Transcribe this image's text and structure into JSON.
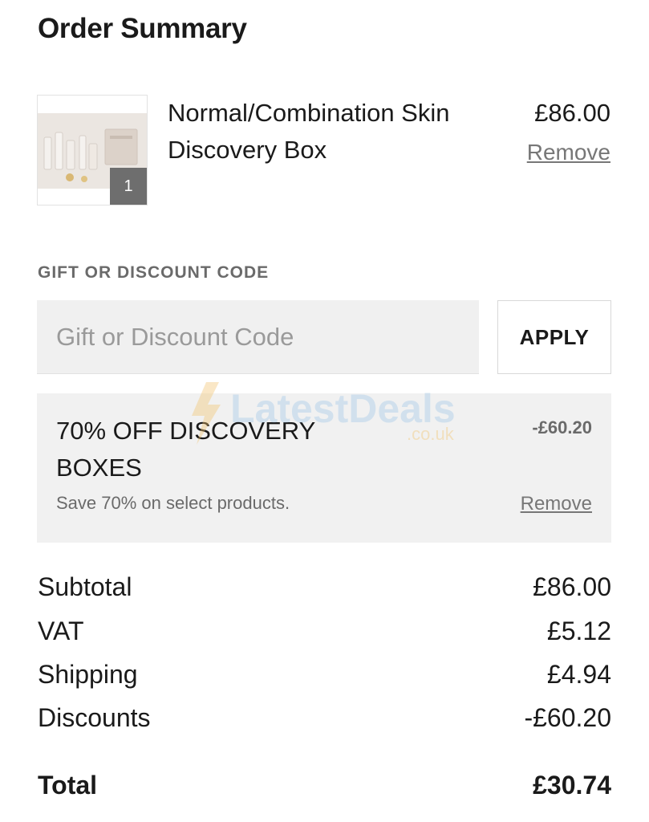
{
  "page": {
    "title": "Order Summary"
  },
  "cart": {
    "item": {
      "name": "Normal/Combination Skin Discovery Box",
      "price": "£86.00",
      "quantity": "1",
      "remove_label": "Remove",
      "thumbnail_icon": "product-photo-icon"
    }
  },
  "discount": {
    "heading": "GIFT OR DISCOUNT CODE",
    "input_placeholder": "Gift or Discount Code",
    "input_value": "",
    "apply_label": "APPLY",
    "applied": {
      "name": "70% OFF DISCOVERY BOXES",
      "amount": "-£60.20",
      "description": "Save 70% on select products.",
      "remove_label": "Remove"
    }
  },
  "watermark": {
    "text": "LatestDeals",
    "sub": ".co.uk"
  },
  "totals": {
    "subtotal": {
      "label": "Subtotal",
      "value": "£86.00"
    },
    "vat": {
      "label": "VAT",
      "value": "£5.12"
    },
    "shipping": {
      "label": "Shipping",
      "value": "£4.94"
    },
    "discounts": {
      "label": "Discounts",
      "value": "-£60.20"
    },
    "total": {
      "label": "Total",
      "value": "£30.74"
    }
  },
  "colors": {
    "text": "#1a1a1a",
    "muted": "#6a6a6a",
    "panel": "#f1f1f1",
    "badge": "#6e6e6e"
  }
}
